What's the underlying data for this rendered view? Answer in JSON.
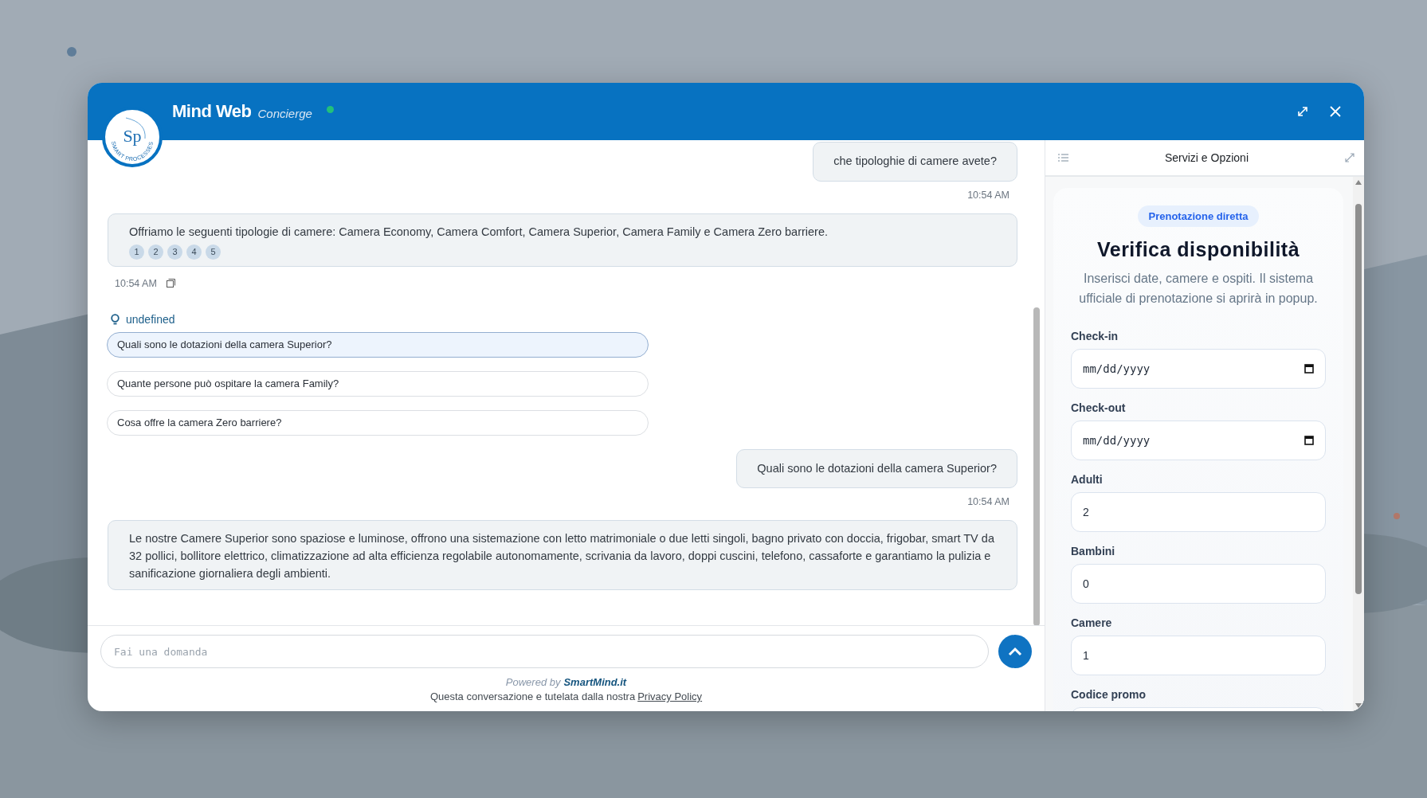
{
  "header": {
    "logo": {
      "monogram": "Sp",
      "tagline": "SMART PROCESSES"
    },
    "title": "Mind Web",
    "subtitle": "Concierge",
    "online": true
  },
  "chat": {
    "messages": [
      {
        "kind": "user",
        "text": "che tipologhie di camere avete?",
        "time": "10:54 AM"
      },
      {
        "kind": "bot",
        "text": "Offriamo le seguenti tipologie di camere: Camera Economy, Camera Comfort, Camera Superior, Camera Family e Camera Zero barriere.",
        "sources": [
          "1",
          "2",
          "3",
          "4",
          "5"
        ],
        "time": "10:54 AM"
      },
      {
        "kind": "suggestions",
        "title": "undefined",
        "items": [
          {
            "text": "Quali sono le dotazioni della camera Superior?",
            "selected": true
          },
          {
            "text": "Quante persone può ospitare la camera Family?",
            "selected": false
          },
          {
            "text": "Cosa offre la camera Zero barriere?",
            "selected": false
          }
        ]
      },
      {
        "kind": "user",
        "text": "Quali sono le dotazioni della camera Superior?",
        "time": "10:54 AM"
      },
      {
        "kind": "bot",
        "text": "Le nostre Camere Superior sono spaziose e luminose, offrono una sistemazione con letto matrimoniale o due letti singoli, bagno privato con doccia, frigobar, smart TV da 32 pollici, bollitore elettrico, climatizzazione ad alta efficienza regolabile autonomamente, scrivania da lavoro, doppi cuscini, telefono, cassaforte e garantiamo la pulizia e sanificazione giornaliera degli ambienti."
      }
    ],
    "input": {
      "placeholder": "Fai una domanda"
    },
    "powered_by": {
      "prefix": "Powered by",
      "brand": "SmartMind.it"
    },
    "privacy": {
      "text": "Questa conversazione e tutelata dalla nostra",
      "link": "Privacy Policy"
    }
  },
  "side_panel": {
    "title": "Servizi e Opzioni",
    "badge": "Prenotazione diretta",
    "heading": "Verifica disponibilità",
    "description": "Inserisci date, camere e ospiti. Il sistema ufficiale di prenotazione si aprirà in popup.",
    "fields": [
      {
        "kind": "date",
        "label": "Check-in",
        "value": "mm/dd/yyyy"
      },
      {
        "kind": "date",
        "label": "Check-out",
        "value": "mm/dd/yyyy"
      },
      {
        "kind": "number",
        "label": "Adulti",
        "value": "2"
      },
      {
        "kind": "number",
        "label": "Bambini",
        "value": "0"
      },
      {
        "kind": "number",
        "label": "Camere",
        "value": "1"
      },
      {
        "kind": "text",
        "label": "Codice promo"
      }
    ]
  }
}
